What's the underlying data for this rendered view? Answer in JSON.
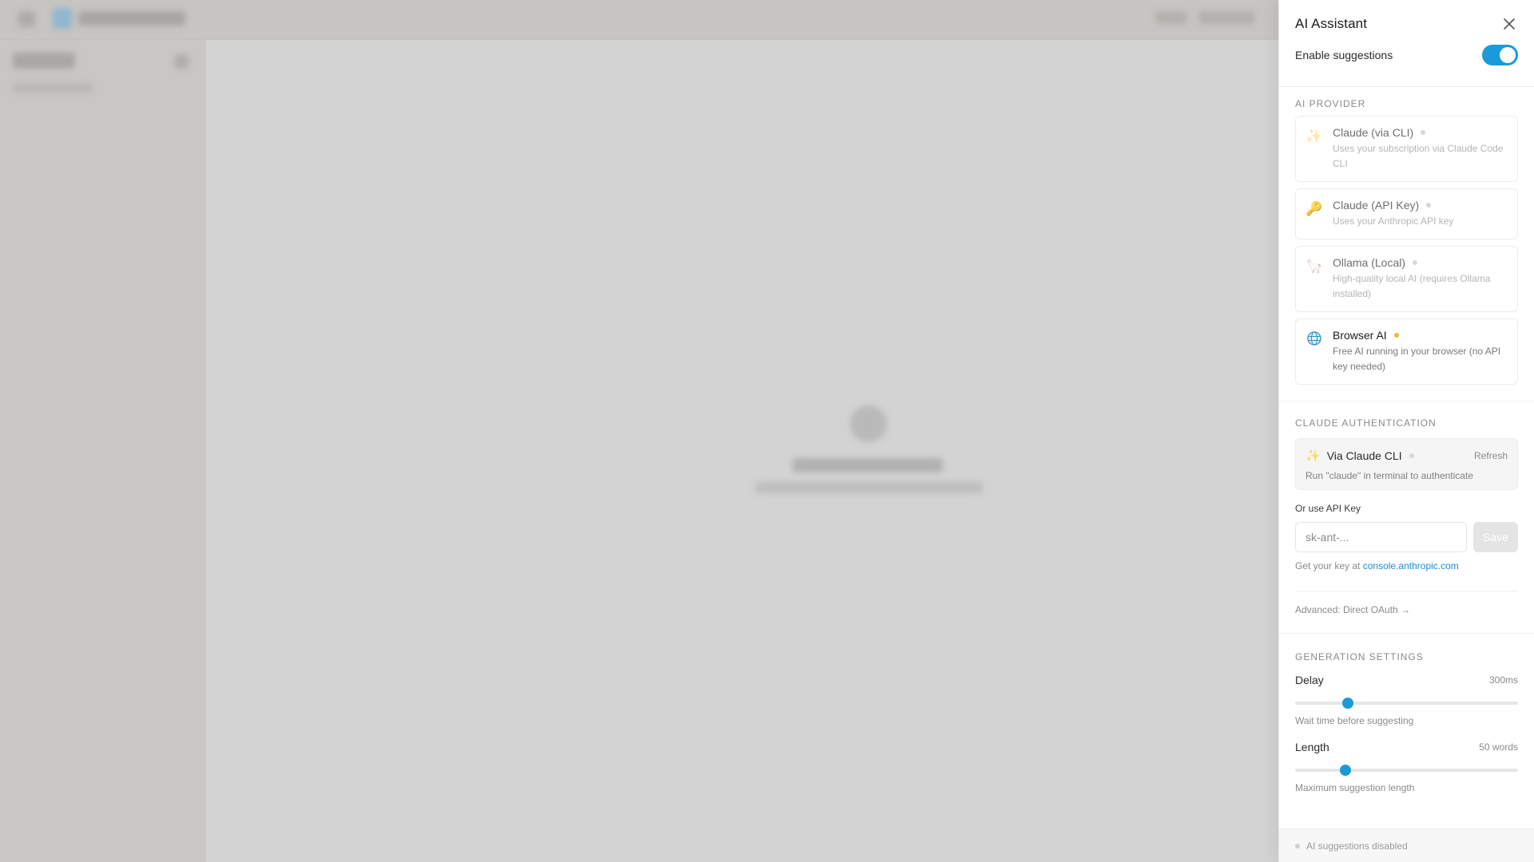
{
  "panel": {
    "title": "AI Assistant",
    "enable_label": "Enable suggestions",
    "enabled": true
  },
  "provider": {
    "section_title": "AI Provider",
    "items": [
      {
        "icon": "sparkles-icon",
        "name": "Claude (via CLI)",
        "description": "Uses your subscription via Claude Code CLI",
        "status": "inactive"
      },
      {
        "icon": "key-icon",
        "name": "Claude (API Key)",
        "description": "Uses your Anthropic API key",
        "status": "inactive"
      },
      {
        "icon": "llama-icon",
        "name": "Ollama (Local)",
        "description": "High-quality local AI (requires Ollama installed)",
        "status": "inactive"
      },
      {
        "icon": "globe-icon",
        "name": "Browser AI",
        "description": "Free AI running in your browser (no API key needed)",
        "status": "warning"
      }
    ]
  },
  "auth": {
    "section_title": "Claude Authentication",
    "method": "Via Claude CLI",
    "refresh_label": "Refresh",
    "description": "Run \"claude\" in terminal to authenticate",
    "api_label": "Or use API Key",
    "api_placeholder": "sk-ant-...",
    "api_value": "",
    "save_label": "Save",
    "hint_prefix": "Get your key at",
    "hint_link": "console.anthropic.com",
    "advanced_label": "Advanced: Direct OAuth →"
  },
  "generation": {
    "section_title": "Generation Settings",
    "delay": {
      "label": "Delay",
      "value": "300ms",
      "fraction": 0.235,
      "hint": "Wait time before suggesting"
    },
    "length": {
      "label": "Length",
      "value": "50 words",
      "fraction": 0.225,
      "hint": "Maximum suggestion length"
    }
  },
  "status": {
    "text": "AI suggestions disabled"
  },
  "colors": {
    "accent": "#1a9bd7",
    "warning": "#f5b731",
    "link": "#1a8fd0"
  }
}
